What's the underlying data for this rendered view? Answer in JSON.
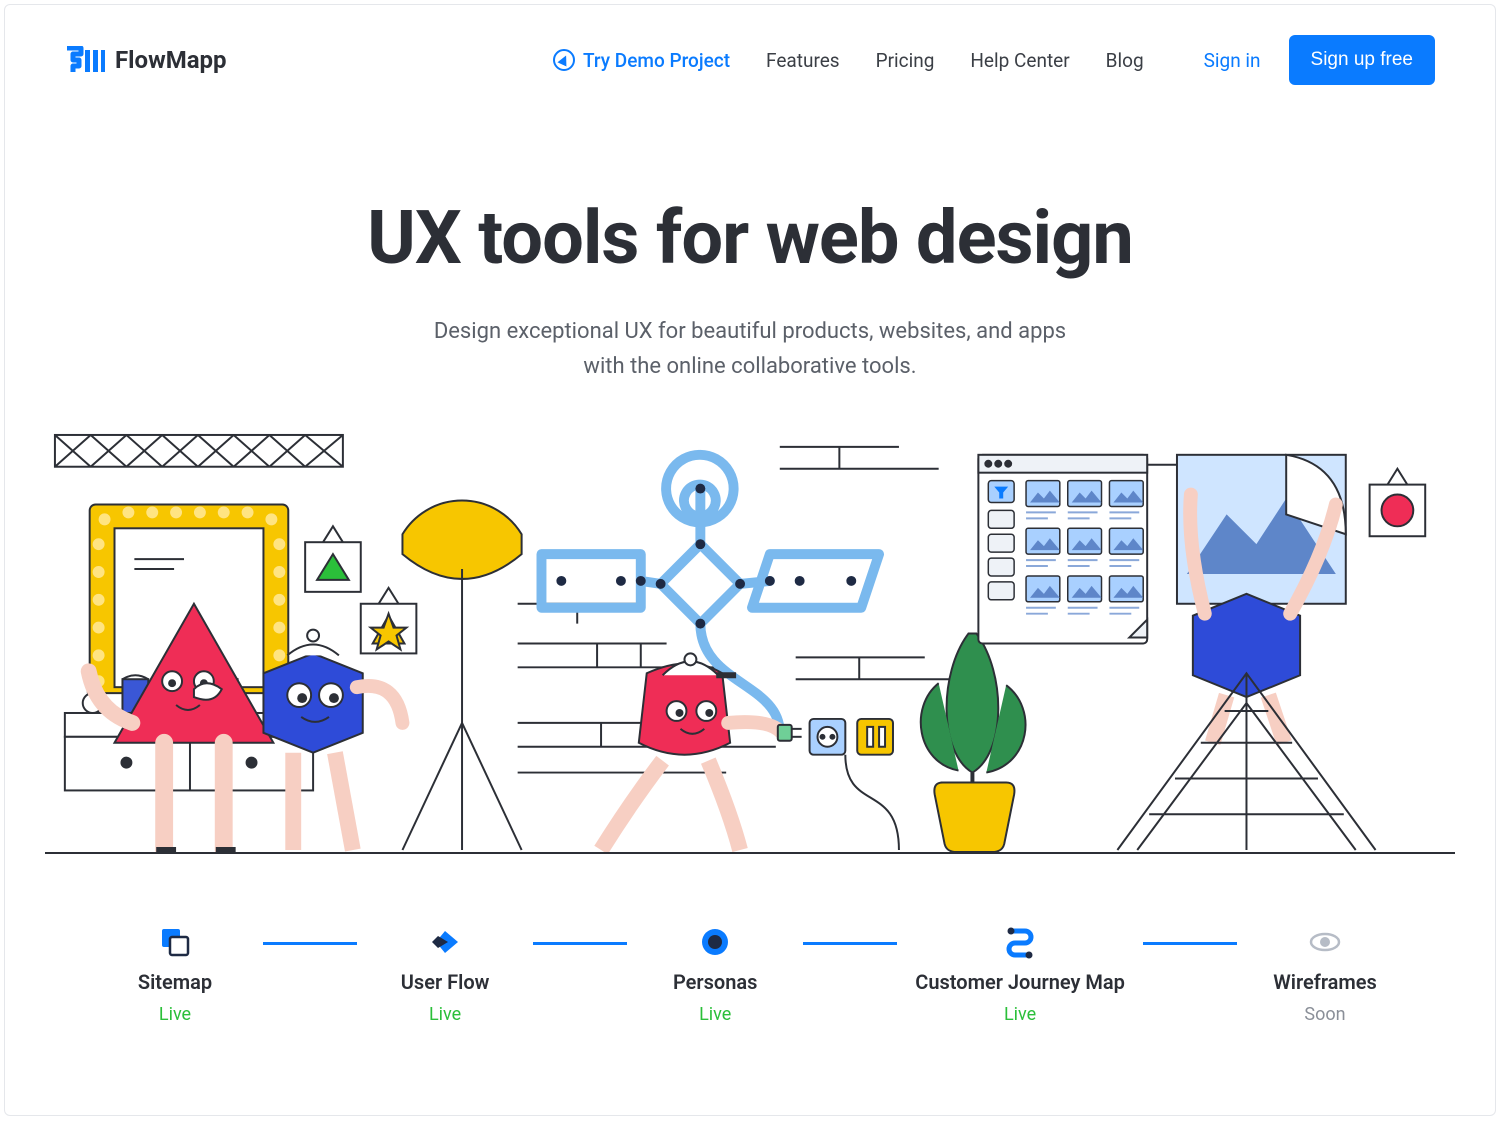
{
  "brand": {
    "name": "FlowMapp"
  },
  "nav": {
    "demo": "Try Demo Project",
    "items": [
      "Features",
      "Pricing",
      "Help Center",
      "Blog"
    ]
  },
  "auth": {
    "signin": "Sign in",
    "signup": "Sign up free"
  },
  "hero": {
    "title": "UX tools for web design",
    "subtitle_line1": "Design exceptional UX for beautiful products, websites, and apps",
    "subtitle_line2": "with the online collaborative tools."
  },
  "features": [
    {
      "label": "Sitemap",
      "status": "Live",
      "status_kind": "live",
      "icon": "sitemap"
    },
    {
      "label": "User Flow",
      "status": "Live",
      "status_kind": "live",
      "icon": "userflow"
    },
    {
      "label": "Personas",
      "status": "Live",
      "status_kind": "live",
      "icon": "personas"
    },
    {
      "label": "Customer Journey Map",
      "status": "Live",
      "status_kind": "live",
      "icon": "cjm"
    },
    {
      "label": "Wireframes",
      "status": "Soon",
      "status_kind": "soon",
      "icon": "wireframes"
    }
  ],
  "colors": {
    "accent": "#0a7bff",
    "text": "#2c2f36",
    "muted": "#5b6069",
    "live": "#2bbf3a",
    "soon": "#8a8f98"
  }
}
